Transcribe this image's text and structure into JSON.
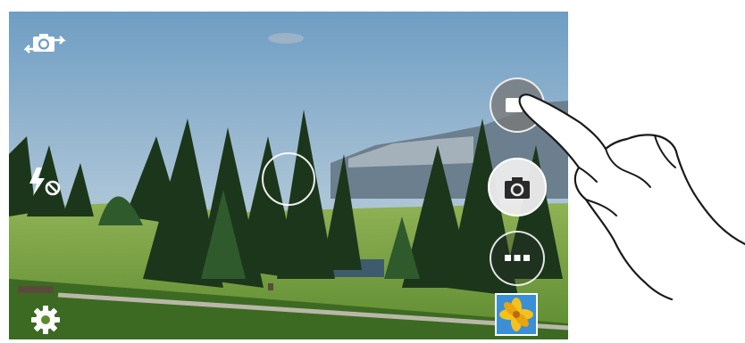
{
  "camera": {
    "controls": {
      "switch_camera": {
        "icon": "switch-camera-icon"
      },
      "flash": {
        "icon": "flash-off-icon",
        "state": "off"
      },
      "settings": {
        "icon": "gear-icon"
      },
      "record": {
        "icon": "video-camera-icon"
      },
      "capture": {
        "icon": "camera-icon"
      },
      "mode": {
        "icon": "more-dots-icon"
      },
      "gallery": {
        "icon": "gallery-thumbnail"
      }
    },
    "focus": {
      "shape": "circle"
    }
  },
  "colors": {
    "overlay_icon": "#ffffff",
    "capture_button": "#ebebeb",
    "record_button": "#787878",
    "hand_outline": "#1a1a1a",
    "sky": "#8fb4d2",
    "grass": "#6e9f3a",
    "trees": "#1f3a1e"
  }
}
